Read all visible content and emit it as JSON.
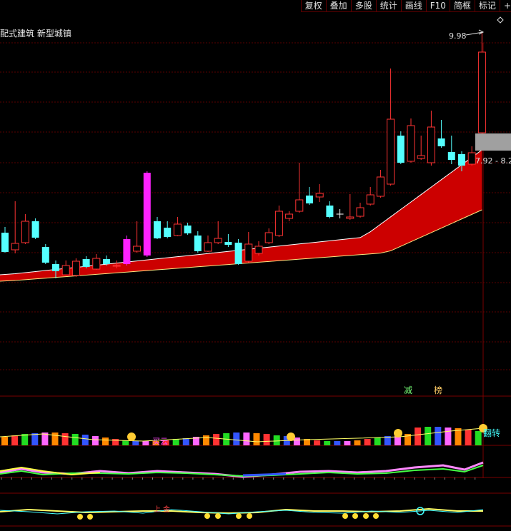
{
  "toolbar": {
    "buttons": [
      "复权",
      "叠加",
      "多股",
      "统计",
      "画线",
      "F10",
      "简框",
      "标记",
      "+"
    ]
  },
  "header": {
    "stock_text": "配式建筑 新型城镇"
  },
  "price": {
    "high_label": "9.98",
    "range_label": "7.92 - 8.2"
  },
  "indicators": {
    "signal1": "减",
    "signal2": "榜",
    "label_buy": "买云",
    "label_turn": "翻转",
    "label_up": "上",
    "label_jin": "金"
  },
  "colors": {
    "up": "#ff3333",
    "down": "#55ffff",
    "magenta": "#ff22ff",
    "band": "#cc0000",
    "grid": "#5a0000"
  },
  "candles": [
    {
      "o": 326,
      "c": 353,
      "h": 318,
      "l": 354,
      "t": "d"
    },
    {
      "o": 350,
      "c": 341,
      "h": 282,
      "l": 355,
      "t": "u"
    },
    {
      "o": 340,
      "c": 310,
      "h": 300,
      "l": 342,
      "t": "u"
    },
    {
      "o": 310,
      "c": 333,
      "h": 306,
      "l": 335,
      "t": "d"
    },
    {
      "o": 346,
      "c": 368,
      "h": 342,
      "l": 370,
      "t": "d"
    },
    {
      "o": 370,
      "c": 380,
      "h": 365,
      "l": 390,
      "t": "d"
    },
    {
      "o": 385,
      "c": 372,
      "h": 365,
      "l": 386,
      "t": "u"
    },
    {
      "o": 386,
      "c": 366,
      "h": 362,
      "l": 388,
      "t": "u"
    },
    {
      "o": 363,
      "c": 374,
      "h": 359,
      "l": 376,
      "t": "d"
    },
    {
      "o": 377,
      "c": 362,
      "h": 356,
      "l": 378,
      "t": "u"
    },
    {
      "o": 363,
      "c": 370,
      "h": 358,
      "l": 372,
      "t": "d"
    },
    {
      "o": 372,
      "c": 372,
      "h": 365,
      "l": 376,
      "t": "u"
    },
    {
      "o": 370,
      "c": 335,
      "h": 330,
      "l": 372,
      "t": "m"
    },
    {
      "o": 352,
      "c": 345,
      "h": 310,
      "l": 354,
      "t": "u"
    },
    {
      "o": 358,
      "c": 242,
      "h": 240,
      "l": 360,
      "t": "m"
    },
    {
      "o": 310,
      "c": 334,
      "h": 304,
      "l": 335,
      "t": "d"
    },
    {
      "o": 319,
      "c": 332,
      "h": 310,
      "l": 334,
      "t": "d"
    },
    {
      "o": 330,
      "c": 314,
      "h": 304,
      "l": 331,
      "t": "u"
    },
    {
      "o": 316,
      "c": 327,
      "h": 312,
      "l": 329,
      "t": "d"
    },
    {
      "o": 330,
      "c": 352,
      "h": 324,
      "l": 354,
      "t": "d"
    },
    {
      "o": 352,
      "c": 340,
      "h": 330,
      "l": 353,
      "t": "u"
    },
    {
      "o": 340,
      "c": 334,
      "h": 310,
      "l": 342,
      "t": "u"
    },
    {
      "o": 339,
      "c": 343,
      "h": 328,
      "l": 346,
      "t": "d"
    },
    {
      "o": 340,
      "c": 370,
      "h": 335,
      "l": 371,
      "t": "d"
    },
    {
      "o": 366,
      "c": 342,
      "h": 325,
      "l": 368,
      "t": "u"
    },
    {
      "o": 355,
      "c": 345,
      "h": 338,
      "l": 358,
      "t": "u"
    },
    {
      "o": 340,
      "c": 326,
      "h": 320,
      "l": 342,
      "t": "u"
    },
    {
      "o": 330,
      "c": 296,
      "h": 288,
      "l": 332,
      "t": "u"
    },
    {
      "o": 306,
      "c": 300,
      "h": 296,
      "l": 310,
      "t": "u"
    },
    {
      "o": 296,
      "c": 280,
      "h": 228,
      "l": 298,
      "t": "u"
    },
    {
      "o": 274,
      "c": 285,
      "h": 262,
      "l": 287,
      "t": "d"
    },
    {
      "o": 276,
      "c": 271,
      "h": 258,
      "l": 283,
      "t": "u"
    },
    {
      "o": 288,
      "c": 304,
      "h": 282,
      "l": 306,
      "t": "d"
    },
    {
      "o": 300,
      "c": 300,
      "h": 293,
      "l": 306,
      "t": "w"
    },
    {
      "o": 306,
      "c": 304,
      "h": 272,
      "l": 308,
      "t": "u"
    },
    {
      "o": 303,
      "c": 291,
      "h": 284,
      "l": 305,
      "t": "u"
    },
    {
      "o": 286,
      "c": 273,
      "h": 262,
      "l": 288,
      "t": "u"
    },
    {
      "o": 275,
      "c": 248,
      "h": 238,
      "l": 277,
      "t": "u"
    },
    {
      "o": 258,
      "c": 167,
      "h": 96,
      "l": 260,
      "t": "u"
    },
    {
      "o": 190,
      "c": 228,
      "h": 184,
      "l": 230,
      "t": "d"
    },
    {
      "o": 226,
      "c": 176,
      "h": 166,
      "l": 228,
      "t": "u"
    },
    {
      "o": 222,
      "c": 218,
      "h": 190,
      "l": 224,
      "t": "u"
    },
    {
      "o": 228,
      "c": 178,
      "h": 155,
      "l": 232,
      "t": "u"
    },
    {
      "o": 194,
      "c": 205,
      "h": 168,
      "l": 207,
      "t": "d"
    },
    {
      "o": 213,
      "c": 224,
      "h": 190,
      "l": 230,
      "t": "d"
    },
    {
      "o": 216,
      "c": 232,
      "h": 212,
      "l": 240,
      "t": "d"
    },
    {
      "o": 230,
      "c": 214,
      "h": 205,
      "l": 232,
      "t": "u"
    },
    {
      "o": 186,
      "c": 73,
      "h": 45,
      "l": 188,
      "t": "u"
    }
  ]
}
